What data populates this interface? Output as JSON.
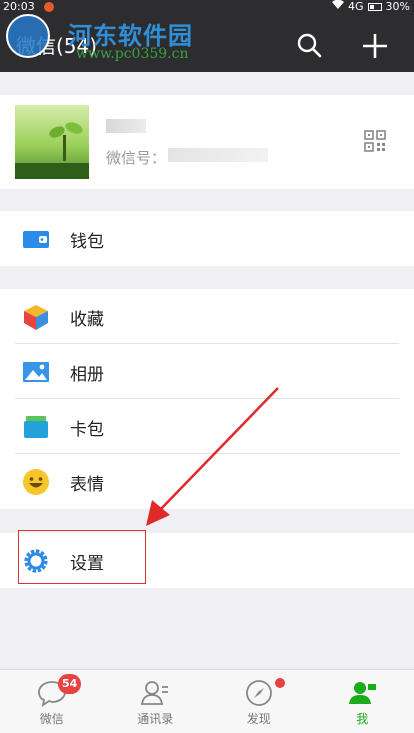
{
  "status_bar": {
    "time": "20:03",
    "network": "4G",
    "battery": "30%"
  },
  "header": {
    "title": "微信(54)"
  },
  "watermark": {
    "site_name": "河东软件园",
    "url": "www.pc0359.cn"
  },
  "profile": {
    "wechat_id_label": "微信号："
  },
  "menu": {
    "wallet": "钱包",
    "favorites": "收藏",
    "album": "相册",
    "cards": "卡包",
    "stickers": "表情",
    "settings": "设置"
  },
  "tabbar": {
    "chats": "微信",
    "chats_badge": "54",
    "contacts": "通讯录",
    "discover": "发现",
    "me": "我"
  },
  "colors": {
    "accent": "#1aad19",
    "highlight": "#dd3333",
    "header": "#2d2d2f"
  }
}
